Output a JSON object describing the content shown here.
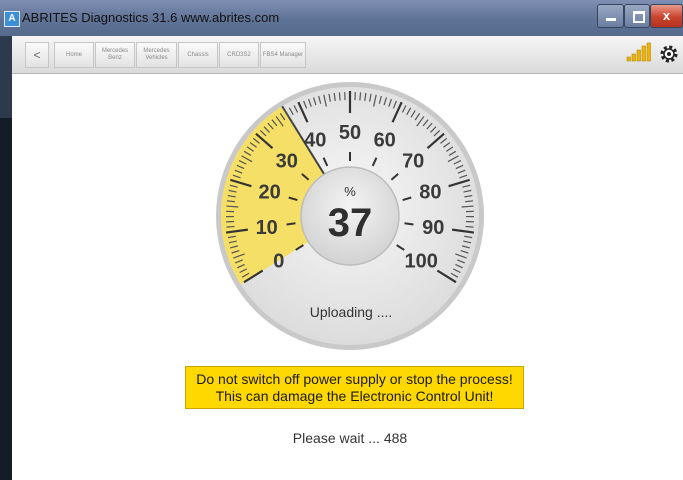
{
  "window": {
    "app_badge": "A",
    "title": "ABRITES Diagnostics 31.6   www.abrites.com",
    "close_glyph": "x"
  },
  "toolbar": {
    "back_glyph": "<",
    "breadcrumbs": [
      {
        "label": "Home"
      },
      {
        "label": "Mercedes Benz"
      },
      {
        "label": "Mercedes Vehicles"
      },
      {
        "label": "Chassis"
      },
      {
        "label": "CRD3S2"
      },
      {
        "label": "FBS4 Manager"
      }
    ],
    "signal_icon": "signal-bars-icon",
    "settings_icon": "gear-icon"
  },
  "gauge": {
    "unit": "%",
    "value": "37",
    "percent": 37,
    "ticks": [
      "0",
      "10",
      "20",
      "30",
      "40",
      "50",
      "60",
      "70",
      "80",
      "90",
      "100"
    ],
    "status": "Uploading ....",
    "fill_color": "#f5df66"
  },
  "warning": {
    "line1": "Do not switch off power supply or stop the process!",
    "line2": "This can damage the Electronic Control Unit!",
    "background": "#ffd800"
  },
  "wait_text": "Please wait ... 488"
}
